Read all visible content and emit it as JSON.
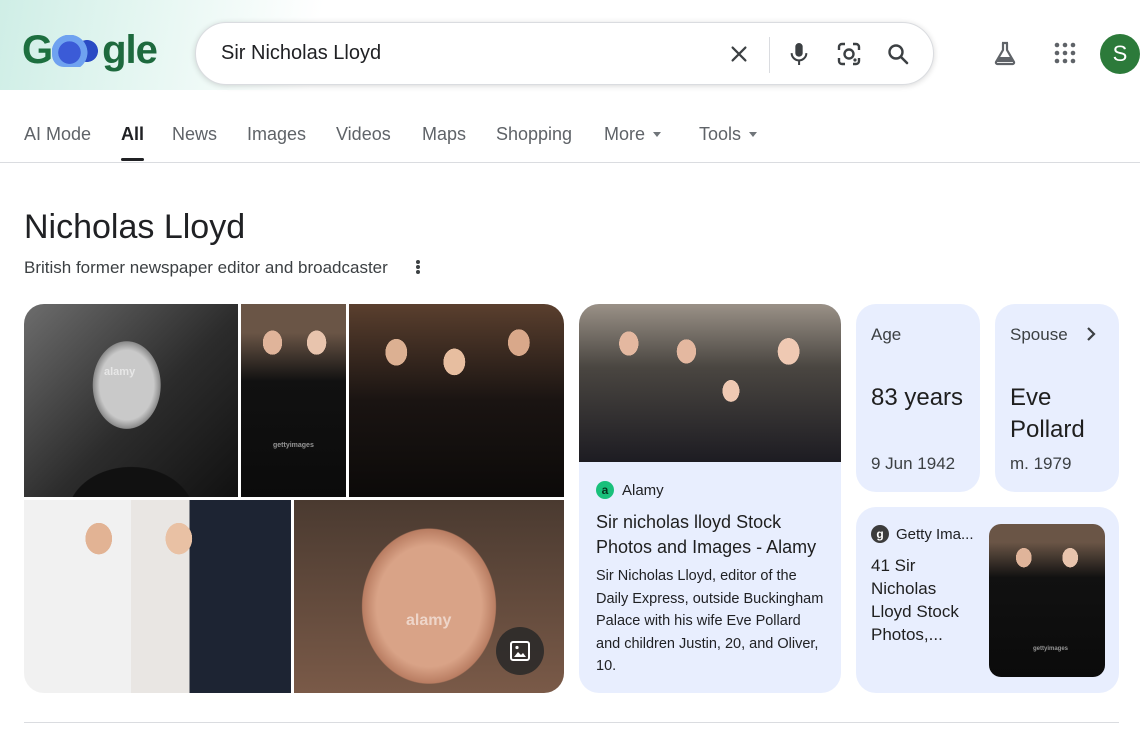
{
  "search": {
    "query": "Sir Nicholas Lloyd"
  },
  "user": {
    "avatar_letter": "S"
  },
  "tabs": [
    {
      "label": "AI Mode"
    },
    {
      "label": "All"
    },
    {
      "label": "News"
    },
    {
      "label": "Images"
    },
    {
      "label": "Videos"
    },
    {
      "label": "Maps"
    },
    {
      "label": "Shopping"
    },
    {
      "label": "More"
    },
    {
      "label": "Tools"
    }
  ],
  "entity": {
    "title": "Nicholas Lloyd",
    "subtitle": "British former newspaper editor and broadcaster"
  },
  "result_alamy": {
    "source": "Alamy",
    "favicon_letter": "a",
    "title": "Sir nicholas lloyd Stock Photos and Images - Alamy",
    "description": "Sir Nicholas Lloyd, editor of the Daily Express, outside Buckingham Palace with his wife Eve Pollard and children Justin, 20, and Oliver, 10."
  },
  "facts": {
    "age": {
      "label": "Age",
      "value": "83 years",
      "sub": "9 Jun 1942"
    },
    "spouse": {
      "label": "Spouse",
      "value": "Eve Pollard",
      "sub": "m. 1979"
    }
  },
  "result_getty": {
    "source": "Getty Ima...",
    "favicon_letter": "g",
    "title": "41 Sir Nicholas Lloyd Stock Photos,..."
  },
  "watermarks": {
    "alamy": "alamy",
    "getty": "gettyimages"
  },
  "colors": {
    "card_bg": "#e8eefe",
    "avatar_bg": "#2c7a3a",
    "alamy_green": "#19c07b"
  },
  "icons": [
    "clear-icon",
    "mic-icon",
    "lens-icon",
    "search-icon",
    "labs-flask-icon",
    "apps-grid-icon",
    "image-search-icon",
    "chevron-right-icon"
  ]
}
